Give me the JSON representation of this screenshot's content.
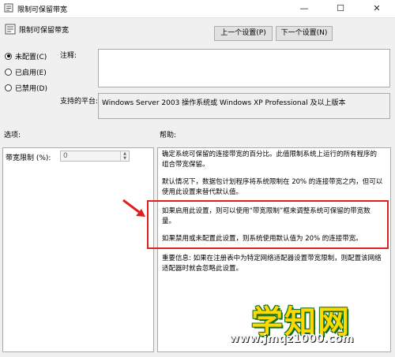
{
  "window": {
    "title": "限制可保留带宽",
    "minimize": "—",
    "maximize": "☐",
    "close": "✕"
  },
  "header": {
    "title": "限制可保留带宽",
    "prev_button": "上一个设置(P)",
    "next_button": "下一个设置(N)"
  },
  "state": {
    "options": [
      {
        "label": "未配置(C)",
        "checked": true
      },
      {
        "label": "已启用(E)",
        "checked": false
      },
      {
        "label": "已禁用(D)",
        "checked": false
      }
    ],
    "comment_label": "注释:",
    "comment_value": "",
    "platform_label": "支持的平台:",
    "platform_value": "Windows Server 2003 操作系统或 Windows XP Professional 及以上版本"
  },
  "options_section": {
    "label": "选项:",
    "bandwidth_label": "带宽限制 (%):",
    "bandwidth_value": "0"
  },
  "help_section": {
    "label": "帮助:",
    "paragraphs": [
      "确定系统可保留的连接带宽的百分比。此值限制系统上运行的所有程序的组合带宽保留。",
      "默认情况下，数据包计划程序将系统限制在 20% 的连接带宽之内，但可以使用此设置来替代默认值。",
      "如果启用此设置，则可以使用“带宽限制”框来调整系统可保留的带宽数量。",
      "如果禁用或未配置此设置，则系统使用默认值为 20% 的连接带宽。",
      "重要信息: 如果在注册表中为特定网络适配器设置带宽限制，则配置该网络适配器时就会忽略此设置。"
    ]
  },
  "watermark": {
    "text": "学知网",
    "url": "www.jmqz1000.com"
  },
  "colors": {
    "annotation_red": "#e0201e",
    "watermark_yellow": "#ffd800"
  }
}
